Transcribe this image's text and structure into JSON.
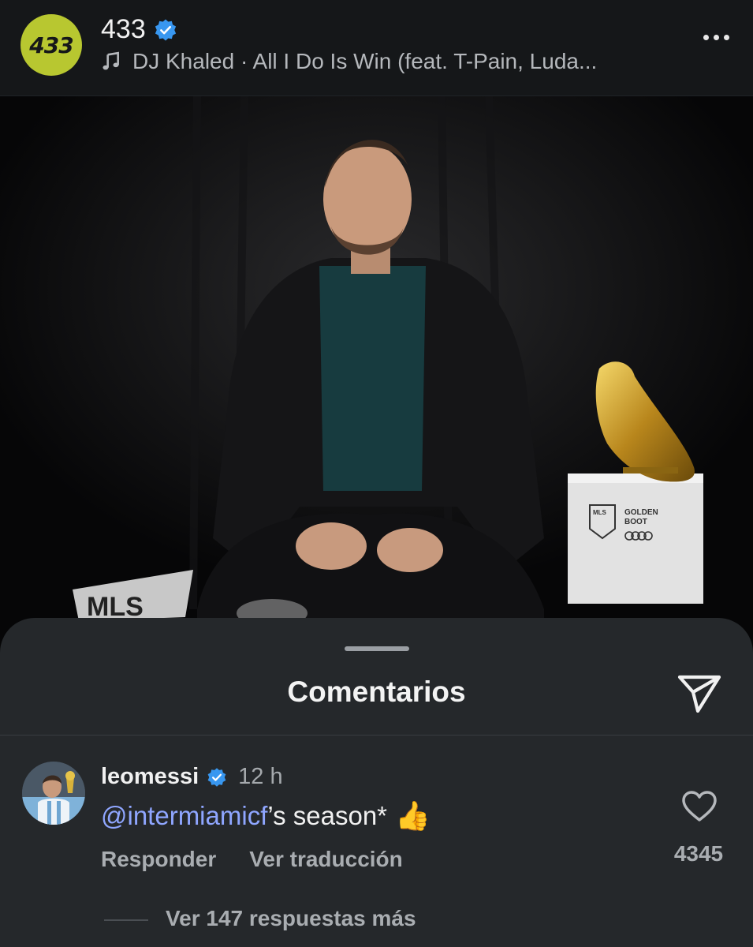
{
  "header": {
    "avatar_text": "433",
    "username": "433",
    "verified": true,
    "music_label": "DJ Khaled · All I Do Is Win (feat. T-Pain, Luda...",
    "icons": {
      "music": "music-note-icon",
      "more": "more-options-icon",
      "verified": "verified-badge-icon"
    }
  },
  "post_image": {
    "trophy_box_brand": "MLS",
    "trophy_box_line1": "GOLDEN",
    "trophy_box_line2": "BOOT",
    "plaque_text": "MLS"
  },
  "comments_sheet": {
    "title": "Comentarios",
    "send_icon": "send-icon",
    "comment": {
      "username": "leomessi",
      "time": "12 h",
      "mention": "@intermiamicf",
      "text": "’s season*",
      "emoji": "👍",
      "reply_label": "Responder",
      "translate_label": "Ver traducción",
      "likes": "4345",
      "view_replies": "Ver 147 respuestas más"
    }
  },
  "colors": {
    "header_bg": "#151719",
    "sheet_bg": "#25282b",
    "mention": "#8fa6ff",
    "verified": "#3897f0",
    "avatar_bg": "#b8c730"
  }
}
